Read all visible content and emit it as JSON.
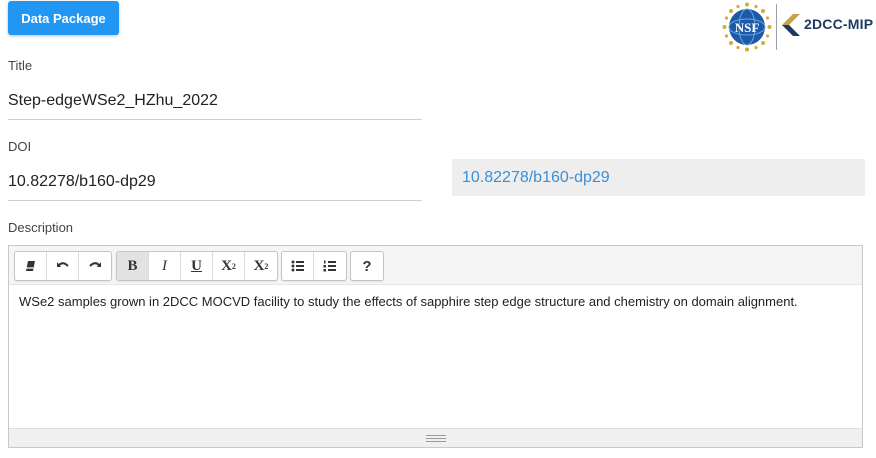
{
  "header": {
    "package_button": "Data Package",
    "logo": {
      "nsf_text": "NSF",
      "mip_text": "2DCC-MIP",
      "nsf_color": "#1a5aa8",
      "mip_color": "#1f3a5f",
      "mip_accent": "#c8a24a"
    }
  },
  "form": {
    "title": {
      "label": "Title",
      "value": "Step-edgeWSe2_HZhu_2022"
    },
    "doi": {
      "label": "DOI",
      "value": "10.82278/b160-dp29",
      "link": "10.82278/b160-dp29"
    },
    "description": {
      "label": "Description",
      "text": "WSe2 samples grown in 2DCC MOCVD facility to study the effects of sapphire step edge structure and chemistry on domain alignment.",
      "toolbar": {
        "group1": [
          "eraser-icon",
          "undo-icon",
          "redo-icon"
        ],
        "bold": "B",
        "italic": "I",
        "underline": "U",
        "superscript": "X",
        "subscript": "X",
        "help": "?"
      }
    }
  },
  "colors": {
    "accent": "#2196f3",
    "link": "#3b8fd9",
    "readonly_bg": "#eeeeee"
  }
}
